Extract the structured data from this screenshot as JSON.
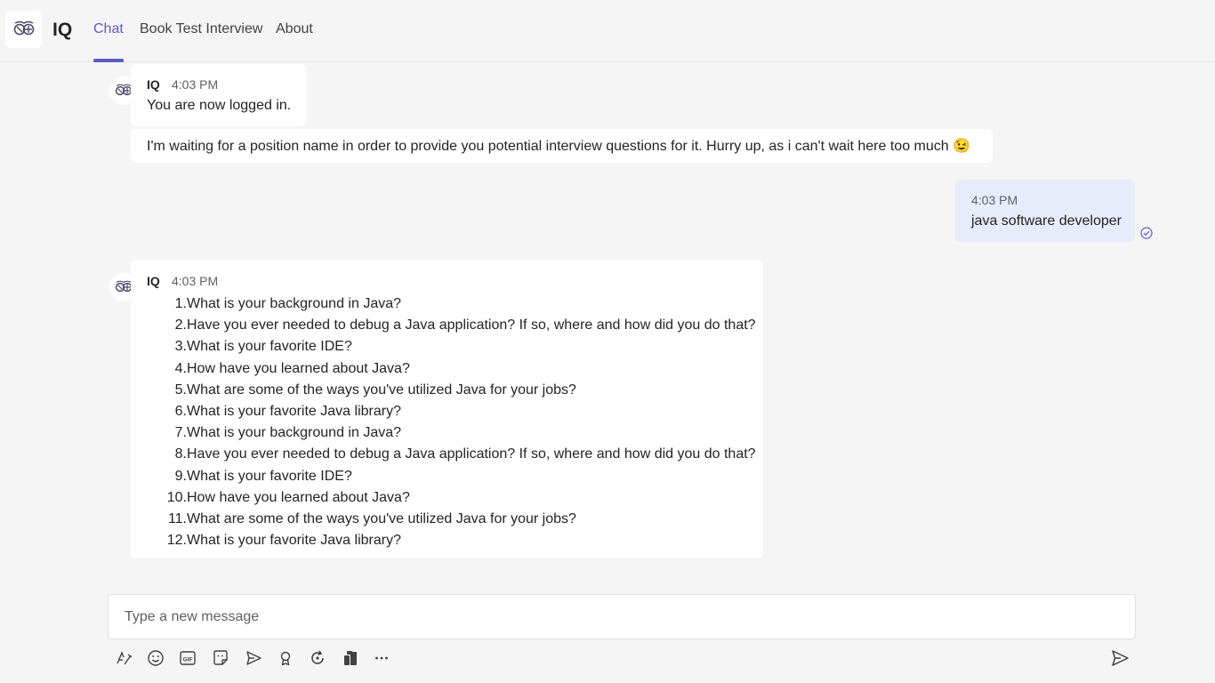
{
  "header": {
    "app_name": "IQ",
    "tabs": [
      {
        "label": "Chat",
        "active": true
      },
      {
        "label": "Book Test Interview",
        "active": false
      },
      {
        "label": "About",
        "active": false
      }
    ]
  },
  "messages": [
    {
      "sender": "IQ",
      "time": "4:03 PM",
      "text": "You are now logged in.",
      "followup": "I'm waiting for a position name in order to provide you potential interview questions for it. Hurry up, as i can't wait here too much 😉"
    },
    {
      "self": true,
      "time": "4:03 PM",
      "text": "java software developer"
    },
    {
      "sender": "IQ",
      "time": "4:03 PM",
      "items": [
        "What is your background in Java?",
        "Have you ever needed to debug a Java application? If so, where and how did you do that?",
        "What is your favorite IDE?",
        "How have you learned about Java?",
        "What are some of the ways you've utilized Java for your jobs?",
        "What is your favorite Java library?",
        "What is your background in Java?",
        "Have you ever needed to debug a Java application? If so, where and how did you do that?",
        "What is your favorite IDE?",
        "How have you learned about Java?",
        "What are some of the ways you've utilized Java for your jobs?",
        "What is your favorite Java library?"
      ],
      "numbers": [
        "1.",
        "2.",
        "3.",
        "4.",
        "5.",
        "6.",
        "7.",
        "8.",
        "9.",
        "10.",
        "11.",
        "12."
      ]
    }
  ],
  "composer": {
    "placeholder": "Type a new message"
  },
  "toolbar_icons": [
    "format-icon",
    "emoji-icon",
    "gif-icon",
    "sticker-icon",
    "schedule-send-icon",
    "praise-icon",
    "loop-icon",
    "apps-icon",
    "more-options-icon"
  ],
  "colors": {
    "accent": "#5b5fc7",
    "self_bubble": "#e8ebfa",
    "presence": "#6bb700",
    "background": "#f5f5f5"
  }
}
